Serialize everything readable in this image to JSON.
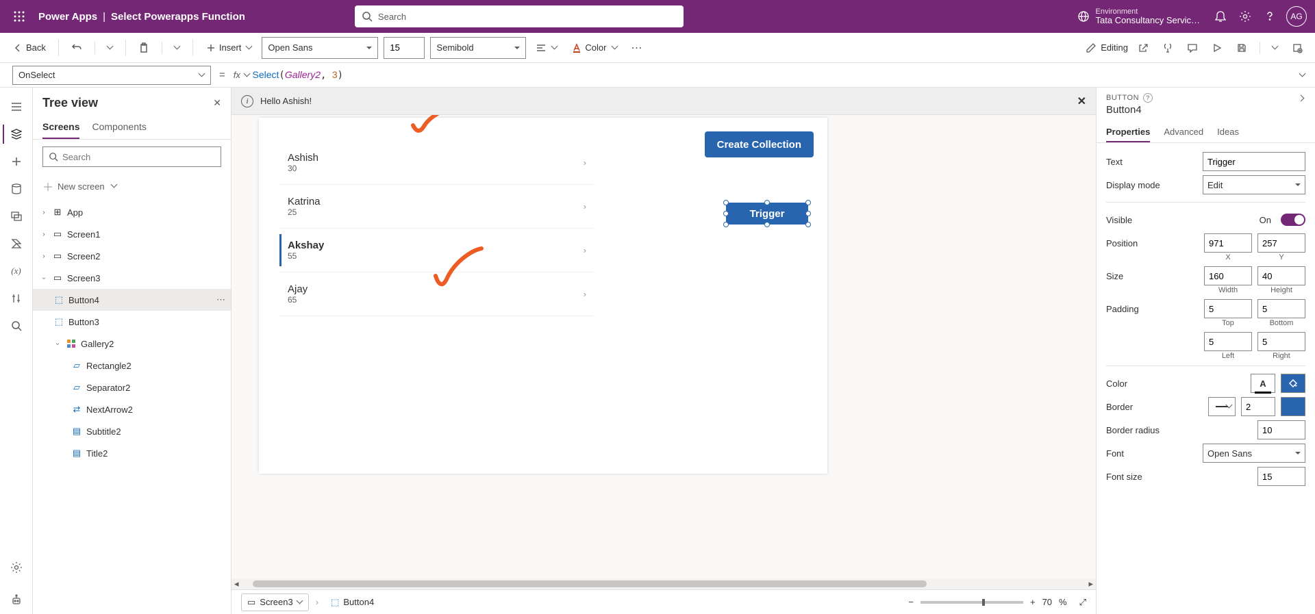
{
  "header": {
    "app": "Power Apps",
    "page": "Select Powerapps Function",
    "search_placeholder": "Search",
    "env_label": "Environment",
    "env_name": "Tata Consultancy Servic…",
    "avatar": "AG"
  },
  "ribbon": {
    "back": "Back",
    "insert": "Insert",
    "font_name": "Open Sans",
    "font_size": "15",
    "font_weight": "Semibold",
    "color": "Color",
    "editing": "Editing"
  },
  "formula": {
    "property": "OnSelect",
    "fn": "Select",
    "arg_id": "Gallery2",
    "arg_num": "3"
  },
  "tree": {
    "title": "Tree view",
    "tab_screens": "Screens",
    "tab_components": "Components",
    "search_placeholder": "Search",
    "new_screen": "New screen",
    "nodes": {
      "app": "App",
      "screen1": "Screen1",
      "screen2": "Screen2",
      "screen3": "Screen3",
      "button4": "Button4",
      "button3": "Button3",
      "gallery2": "Gallery2",
      "rectangle2": "Rectangle2",
      "separator2": "Separator2",
      "nextarrow2": "NextArrow2",
      "subtitle2": "Subtitle2",
      "title2": "Title2"
    }
  },
  "info_bar": {
    "message": "Hello Ashish!"
  },
  "canvas": {
    "create_collection": "Create Collection",
    "trigger": "Trigger",
    "gallery": [
      {
        "title": "Ashish",
        "sub": "30"
      },
      {
        "title": "Katrina",
        "sub": "25"
      },
      {
        "title": "Akshay",
        "sub": "55",
        "selected": true
      },
      {
        "title": "Ajay",
        "sub": "65"
      }
    ]
  },
  "status": {
    "crumb_screen": "Screen3",
    "crumb_control": "Button4",
    "zoom": "70",
    "zoom_unit": "%"
  },
  "props": {
    "type": "BUTTON",
    "name": "Button4",
    "tab_properties": "Properties",
    "tab_advanced": "Advanced",
    "tab_ideas": "Ideas",
    "text_label": "Text",
    "text_value": "Trigger",
    "display_mode_label": "Display mode",
    "display_mode_value": "Edit",
    "visible_label": "Visible",
    "visible_value": "On",
    "position_label": "Position",
    "pos_x": "971",
    "pos_y": "257",
    "pos_x_label": "X",
    "pos_y_label": "Y",
    "size_label": "Size",
    "width": "160",
    "height": "40",
    "width_label": "Width",
    "height_label": "Height",
    "padding_label": "Padding",
    "pad_top": "5",
    "pad_bottom": "5",
    "pad_left": "5",
    "pad_right": "5",
    "pad_top_label": "Top",
    "pad_bottom_label": "Bottom",
    "pad_left_label": "Left",
    "pad_right_label": "Right",
    "color_label": "Color",
    "border_label": "Border",
    "border_value": "2",
    "border_radius_label": "Border radius",
    "border_radius_value": "10",
    "font_label": "Font",
    "font_value": "Open Sans",
    "font_size_label": "Font size",
    "font_size_value": "15"
  }
}
